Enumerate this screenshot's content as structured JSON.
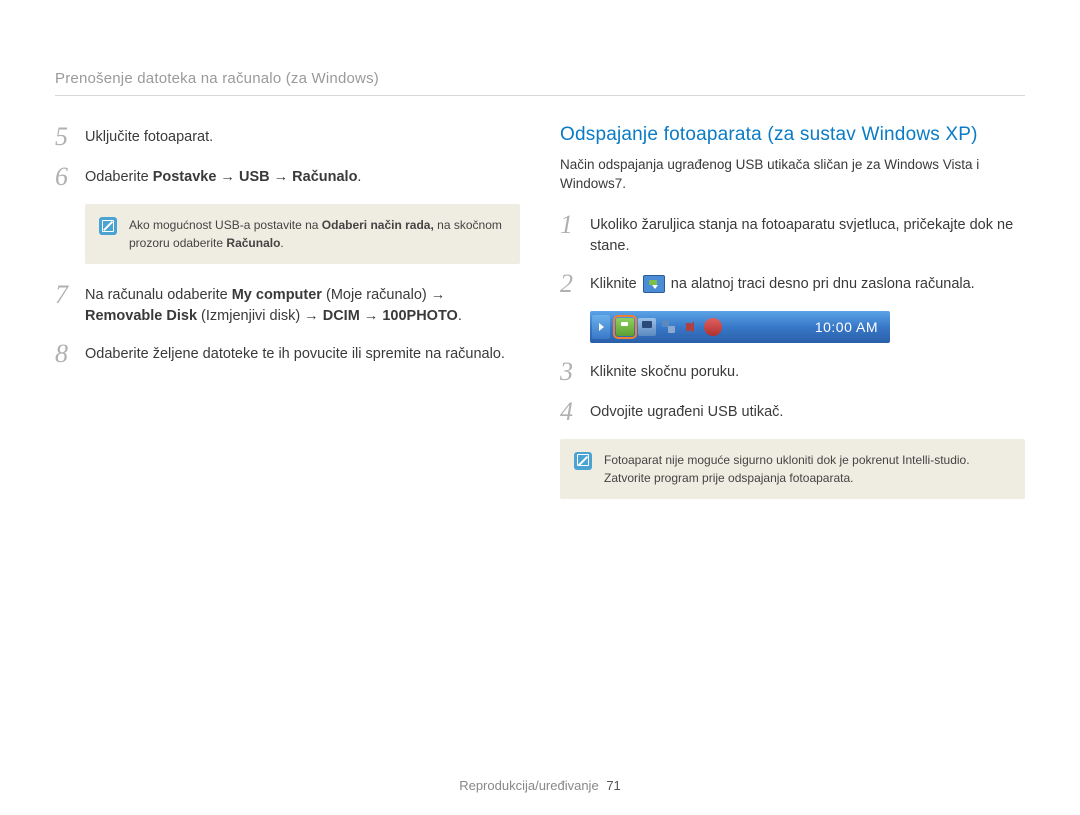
{
  "breadcrumb": "Prenošenje datoteka na računalo (za Windows)",
  "left": {
    "step5": {
      "num": "5",
      "text": "Uključite fotoaparat."
    },
    "step6": {
      "num": "6",
      "prefix": "Odaberite ",
      "menu1": "Postavke",
      "sep1": " → ",
      "menu2": "USB",
      "sep2": " → ",
      "menu3": "Računalo",
      "suffix": "."
    },
    "callout": {
      "seg1": "Ako mogućnost USB-a postavite na ",
      "bold1": "Odaberi način rada,",
      "seg2": " na skočnom prozoru odaberite ",
      "bold2": "Računalo",
      "seg3": "."
    },
    "step7": {
      "num": "7",
      "seg1": "Na računalu odaberite ",
      "m1": "My computer",
      "p1": " (Moje računalo) → ",
      "m2": "Removable Disk",
      "p2": " (Izmjenjivi disk) → ",
      "m3": "DCIM",
      "p3": " → ",
      "m4": "100PHOTO",
      "p4": "."
    },
    "step8": {
      "num": "8",
      "text": "Odaberite željene datoteke te ih povucite ili spremite na računalo."
    }
  },
  "right": {
    "heading": "Odspajanje fotoaparata (za sustav Windows XP)",
    "sub": "Način odspajanja ugrađenog USB utikača sličan je za Windows Vista i Windows7.",
    "step1": {
      "num": "1",
      "text": "Ukoliko žaruljica stanja na fotoaparatu svjetluca, pričekajte dok ne stane."
    },
    "step2": {
      "num": "2",
      "seg1": "Kliknite ",
      "seg2": " na alatnoj traci desno pri dnu zaslona računala."
    },
    "taskbar": {
      "clock": "10:00 AM"
    },
    "step3": {
      "num": "3",
      "text": "Kliknite skočnu poruku."
    },
    "step4": {
      "num": "4",
      "text": "Odvojite ugrađeni USB utikač."
    },
    "callout": {
      "text": "Fotoaparat nije moguće sigurno ukloniti dok je pokrenut Intelli-studio. Zatvorite program prije odspajanja fotoaparata."
    }
  },
  "footer": {
    "label": "Reprodukcija/uređivanje",
    "page": "71"
  }
}
